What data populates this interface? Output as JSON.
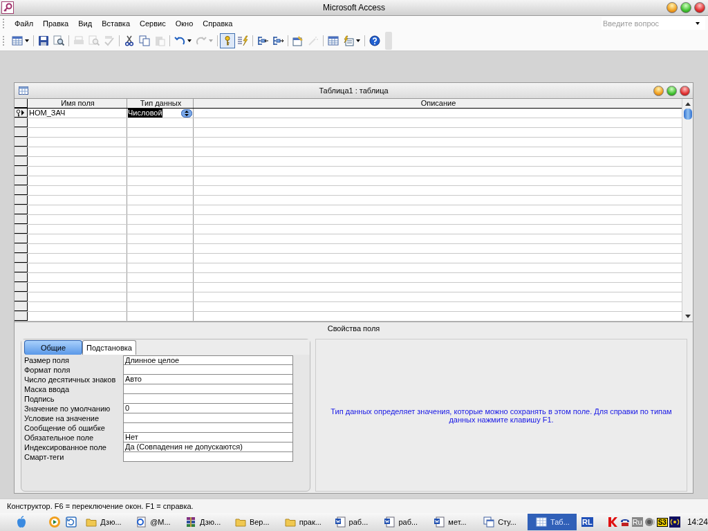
{
  "window": {
    "title": "Microsoft Access"
  },
  "menu": [
    {
      "label": "Файл"
    },
    {
      "label": "Правка"
    },
    {
      "label": "Вид"
    },
    {
      "label": "Вставка"
    },
    {
      "label": "Сервис"
    },
    {
      "label": "Окно"
    },
    {
      "label": "Справка"
    }
  ],
  "question_box": {
    "placeholder": "Введите вопрос"
  },
  "toolbar": [
    [
      {
        "kind": "view",
        "disabled": false,
        "pressed": false,
        "menu": true
      }
    ],
    [
      {
        "kind": "save",
        "disabled": false,
        "pressed": false,
        "menu": false
      },
      {
        "kind": "search",
        "disabled": false,
        "pressed": false,
        "menu": false
      }
    ],
    [
      {
        "kind": "print",
        "disabled": true,
        "pressed": false,
        "menu": false
      },
      {
        "kind": "preview",
        "disabled": true,
        "pressed": false,
        "menu": false
      },
      {
        "kind": "spell",
        "disabled": true,
        "pressed": false,
        "menu": false
      }
    ],
    [
      {
        "kind": "cut",
        "disabled": false,
        "pressed": false,
        "menu": false
      },
      {
        "kind": "copy",
        "disabled": false,
        "pressed": false,
        "menu": false
      },
      {
        "kind": "paste",
        "disabled": true,
        "pressed": false,
        "menu": false
      }
    ],
    [
      {
        "kind": "undo",
        "disabled": false,
        "pressed": false,
        "menu": true
      },
      {
        "kind": "redo",
        "disabled": true,
        "pressed": false,
        "menu": true
      }
    ],
    [
      {
        "kind": "key",
        "disabled": false,
        "pressed": true,
        "menu": false
      },
      {
        "kind": "builder",
        "disabled": false,
        "pressed": false,
        "menu": false
      }
    ],
    [
      {
        "kind": "insert_rows",
        "disabled": false,
        "pressed": false,
        "menu": false
      },
      {
        "kind": "delete_rows",
        "disabled": false,
        "pressed": false,
        "menu": false
      }
    ],
    [
      {
        "kind": "properties",
        "disabled": false,
        "pressed": false,
        "menu": false
      },
      {
        "kind": "build",
        "disabled": true,
        "pressed": false,
        "menu": false
      }
    ],
    [
      {
        "kind": "db_window",
        "disabled": false,
        "pressed": false,
        "menu": false
      },
      {
        "kind": "new_object",
        "disabled": false,
        "pressed": false,
        "menu": true
      }
    ],
    [
      {
        "kind": "help",
        "disabled": false,
        "pressed": false,
        "menu": false
      }
    ]
  ],
  "document": {
    "title": "Таблица1 : таблица",
    "columns": [
      {
        "label": "Имя поля"
      },
      {
        "label": "Тип данных"
      },
      {
        "label": "Описание"
      }
    ],
    "rows": [
      {
        "name": "НОМ_ЗАЧ",
        "type": "Числовой",
        "primary_key": true,
        "current": true,
        "type_selected": true
      }
    ],
    "properties_caption": "Свойства поля",
    "tabs": [
      {
        "label": "Общие",
        "selected": true
      },
      {
        "label": "Подстановка",
        "selected": false
      }
    ],
    "properties": [
      {
        "label": "Размер поля",
        "value": "Длинное целое"
      },
      {
        "label": "Формат поля"
      },
      {
        "label": "Число десятичных знаков",
        "value": "Авто"
      },
      {
        "label": "Маска ввода"
      },
      {
        "label": "Подпись"
      },
      {
        "label": "Значение по умолчанию",
        "value": "0"
      },
      {
        "label": "Условие на значение"
      },
      {
        "label": "Сообщение об ошибке"
      },
      {
        "label": "Обязательное поле",
        "value": "Нет"
      },
      {
        "label": "Индексированное поле",
        "value": "Да (Совпадения не допускаются)"
      },
      {
        "label": "Смарт-теги"
      }
    ],
    "help_text": "Тип данных определяет значения, которые можно сохранять в этом поле.  Для справки по типам данных нажмите клавишу F1."
  },
  "status_bar": {
    "text": "Конструктор.  F6 = переключение окон.  F1 = справка."
  },
  "taskbar": {
    "quick_launch": [
      {
        "kind": "apple"
      },
      {
        "kind": "player"
      },
      {
        "kind": "refresh"
      }
    ],
    "tasks": [
      {
        "kind": "folder",
        "label": "Дзю...",
        "selected": false
      },
      {
        "kind": "browser",
        "label": "@М...",
        "selected": false
      },
      {
        "kind": "archive",
        "label": "Дзю...",
        "selected": false
      },
      {
        "kind": "folder",
        "label": "Вер...",
        "selected": false
      },
      {
        "kind": "folder",
        "label": "прак...",
        "selected": false
      },
      {
        "kind": "word",
        "label": "раб...",
        "selected": false
      },
      {
        "kind": "word",
        "label": "раб...",
        "selected": false
      },
      {
        "kind": "word",
        "label": "мет...",
        "selected": false
      },
      {
        "kind": "window",
        "label": "Сту...",
        "selected": false
      },
      {
        "kind": "table",
        "label": "Таб...",
        "selected": true
      }
    ],
    "lang": "RL",
    "tray": [
      {
        "kind": "shield"
      },
      {
        "kind": "phone"
      },
      {
        "kind": "badge",
        "text": "Ru"
      },
      {
        "kind": "speaker"
      },
      {
        "kind": "yellow",
        "text": "S3"
      },
      {
        "kind": "radio"
      }
    ],
    "clock": "14:24"
  }
}
